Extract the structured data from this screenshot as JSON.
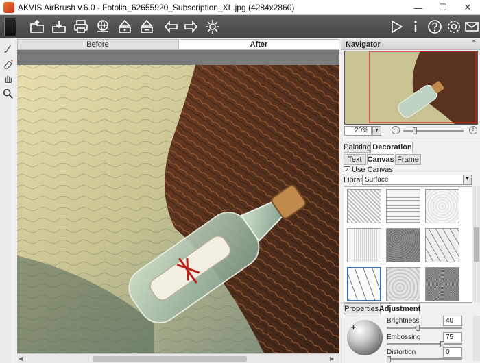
{
  "window": {
    "title": "AKVIS AirBrush v.6.0 - Fotolia_62655920_Subscription_XL.jpg (4284x2860)",
    "minimize": "—",
    "maximize": "☐",
    "close": "✕"
  },
  "toolbar": {
    "left_icons": [
      "open-icon",
      "save-icon",
      "print-icon",
      "share-icon",
      "batch-icon",
      "plugin-icon",
      "undo-arrow-icon",
      "redo-arrow-icon",
      "settings-gear-icon"
    ],
    "right_icons": [
      "run-icon",
      "info-icon",
      "help-icon",
      "preferences-icon",
      "contact-icon"
    ]
  },
  "left_tools": [
    "brush-tool-icon",
    "eraser-tool-icon",
    "hand-tool-icon",
    "zoom-tool-icon"
  ],
  "canvas_tabs": {
    "before": "Before",
    "after": "After",
    "active": "After"
  },
  "navigator": {
    "title": "Navigator",
    "zoom_value": "20%",
    "zoom_minus": "−",
    "zoom_plus": "+"
  },
  "settings_tabs": {
    "painting": "Painting",
    "decoration": "Decoration",
    "active": "Decoration"
  },
  "decoration_tabs": {
    "text": "Text",
    "canvas": "Canvas",
    "frame": "Frame",
    "active": "Canvas"
  },
  "use_canvas": {
    "label": "Use Canvas",
    "checked": true
  },
  "library": {
    "label": "Library",
    "value": "Surface"
  },
  "texture_selected_index": 6,
  "bottom_tabs": {
    "properties": "Properties",
    "adjustment": "Adjustment",
    "active": "Adjustment"
  },
  "adjustment": {
    "brightness": {
      "label": "Brightness",
      "value": "40",
      "fraction": 0.4
    },
    "embossing": {
      "label": "Embossing",
      "value": "75",
      "fraction": 0.75
    },
    "distortion": {
      "label": "Distortion",
      "value": "0",
      "fraction": 0.0
    }
  },
  "colors": {
    "toolbar": "#4f4f4f",
    "panel": "#f0f0f0",
    "accent_border": "#3a6fb0"
  }
}
